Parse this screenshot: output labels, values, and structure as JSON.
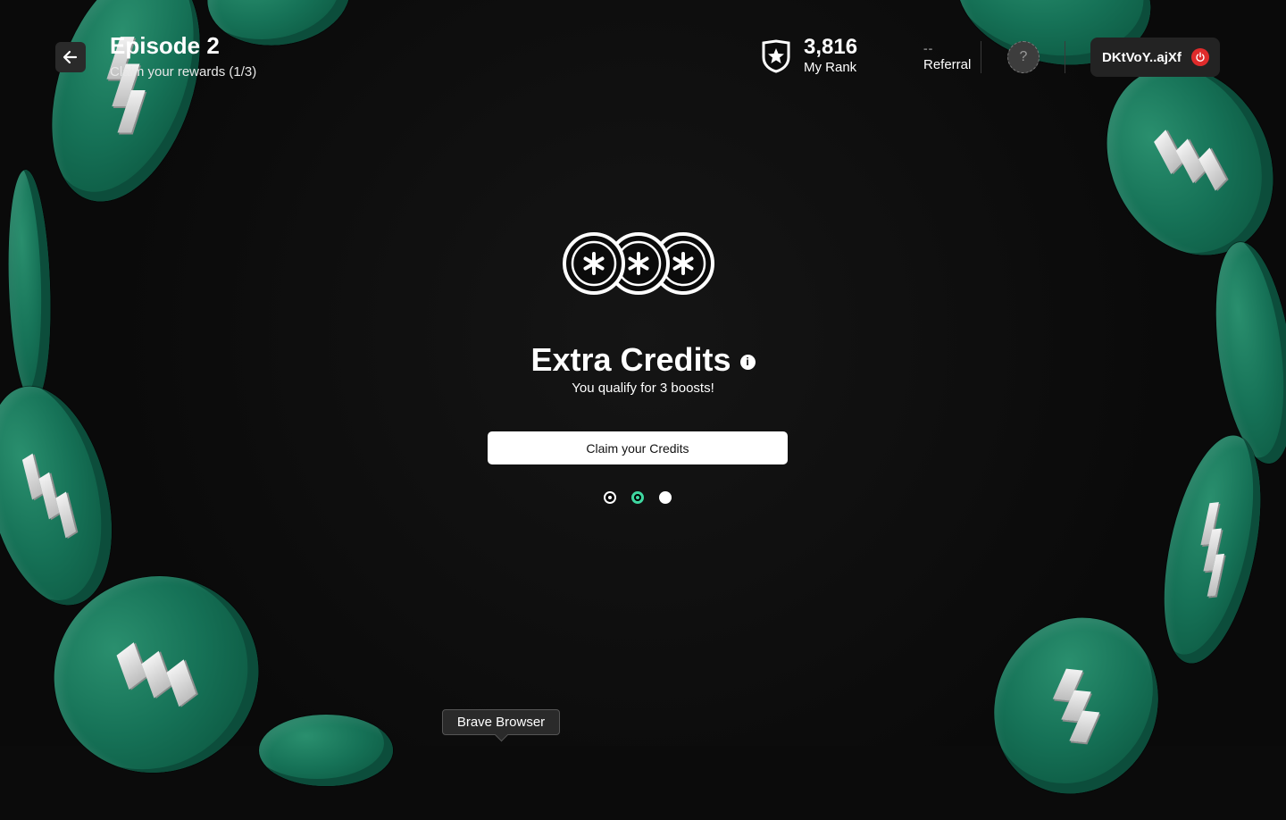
{
  "header": {
    "back_icon": "arrow-left-icon",
    "episode_title": "Episode 2",
    "episode_subtitle": "Claim your rewards (1/3)",
    "rank_icon": "shield-star-icon",
    "rank_value": "3,816",
    "rank_label": "My Rank",
    "referral_value": "--",
    "referral_label": "Referral",
    "help_icon": "question-icon",
    "help_glyph": "?",
    "wallet_address": "DKtVoY..ajXf",
    "power_icon": "power-icon"
  },
  "reward": {
    "icon": "credit-coins-icon",
    "title": "Extra Credits",
    "info_glyph": "i",
    "subtitle": "You qualify for 3 boosts!",
    "claim_label": "Claim your Credits"
  },
  "steps": {
    "total": 3,
    "current": 2,
    "states": [
      "done",
      "active",
      "pending"
    ]
  },
  "tooltip": {
    "text": "Brave Browser"
  },
  "colors": {
    "background": "#0b0b0b",
    "coin_green": "#167257",
    "active_step": "#3fd7a0",
    "power_red": "#e02b2b"
  }
}
